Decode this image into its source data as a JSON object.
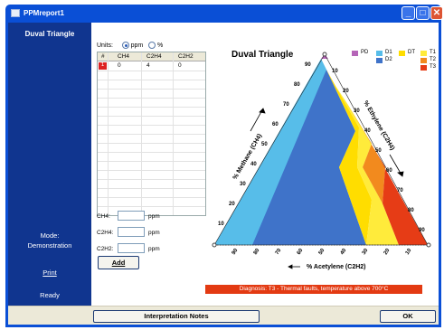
{
  "window": {
    "title": "PPMreport1"
  },
  "sidebar": {
    "heading": "Duval Triangle",
    "mode_label": "Mode:",
    "mode_value": "Demonstration",
    "print_link": "Print",
    "status": "Ready"
  },
  "units": {
    "label": "Units:",
    "options": [
      "ppm",
      "%"
    ],
    "selected": "ppm"
  },
  "table": {
    "columns": [
      "#",
      "CH4",
      "C2H4",
      "C2H2"
    ],
    "rows": [
      [
        "1",
        "0",
        "4",
        "0"
      ]
    ]
  },
  "inputs": [
    {
      "label": "CH4:",
      "value": "",
      "unit": "ppm"
    },
    {
      "label": "C2H4:",
      "value": "",
      "unit": "ppm"
    },
    {
      "label": "C2H2:",
      "value": "",
      "unit": "ppm"
    }
  ],
  "buttons": {
    "add": "Add",
    "notes": "Interpretation Notes",
    "ok": "OK"
  },
  "chart": {
    "title": "Duval Triangle",
    "left_axis_label": "% Methane (CH4)",
    "right_axis_label": "% Ethylene (C2H4)",
    "bottom_axis_label": "% Acetylene (C2H2)",
    "left_ticks": [
      "10",
      "20",
      "30",
      "40",
      "50",
      "60",
      "70",
      "80",
      "90"
    ],
    "right_ticks": [
      "10",
      "20",
      "30",
      "40",
      "50",
      "60",
      "70",
      "80",
      "90"
    ],
    "bottom_ticks": [
      "90",
      "80",
      "70",
      "60",
      "50",
      "40",
      "30",
      "20",
      "10"
    ],
    "legend": [
      {
        "label": "PD",
        "color": "#b565b8"
      },
      {
        "label": "D1",
        "color": "#57bde9"
      },
      {
        "label": "DT",
        "color": "#ffdd00"
      },
      {
        "label": "T1",
        "color": "#ffeb3b"
      },
      {
        "label": "D2",
        "color": "#3f73c9"
      },
      {
        "label": "T2",
        "color": "#f28a1e"
      },
      {
        "label": "T3",
        "color": "#e63c16"
      }
    ],
    "diagnosis": "Diagnosis: T3 - Thermal faults, temperature above 700°C"
  },
  "colors": {
    "title_bar": "#0a4fd6",
    "sidebar": "#10358f",
    "pd": "#b565b8",
    "d1": "#57bde9",
    "d2": "#3f73c9",
    "dt": "#ffdd00",
    "t1": "#ffeb3b",
    "t2": "#f28a1e",
    "t3": "#e63c16"
  }
}
